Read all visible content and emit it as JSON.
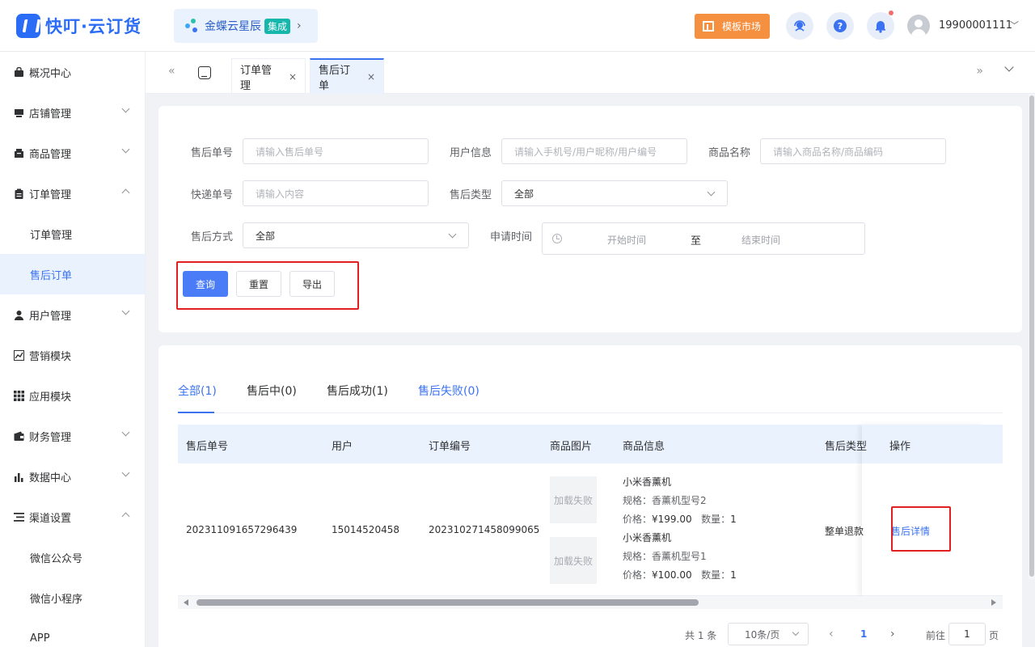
{
  "header": {
    "brand": "快叮·云订货",
    "partner": {
      "name": "金蝶云星辰",
      "badge": "集成",
      "arrow": "›"
    },
    "template_market": "模板市场",
    "username": "19900001111",
    "icons": [
      "headset-icon",
      "help-icon",
      "bell-icon"
    ],
    "colors": {
      "brand": "#2b6cf6",
      "accent": "#f59040"
    }
  },
  "sidebar": {
    "items": [
      {
        "label": "概况中心",
        "icon": "bag-icon"
      },
      {
        "label": "店铺管理",
        "icon": "shop-icon"
      },
      {
        "label": "商品管理",
        "icon": "goods-icon"
      },
      {
        "label": "订单管理",
        "icon": "clipboard-icon",
        "children": [
          "订单管理",
          "售后订单"
        ]
      },
      {
        "label": "用户管理",
        "icon": "user-icon"
      },
      {
        "label": "营销模块",
        "icon": "chart-line-icon"
      },
      {
        "label": "应用模块",
        "icon": "grid-icon"
      },
      {
        "label": "财务管理",
        "icon": "wallet-icon"
      },
      {
        "label": "数据中心",
        "icon": "bar-chart-icon"
      },
      {
        "label": "渠道设置",
        "icon": "list-icon",
        "children": [
          "微信公众号",
          "微信小程序",
          "APP"
        ]
      }
    ]
  },
  "tabs": {
    "left": "«",
    "right": "»",
    "items": [
      {
        "label": "订单管理",
        "close": "×"
      },
      {
        "label": "售后订单",
        "close": "×"
      }
    ]
  },
  "filter": {
    "after_sale_no": {
      "label": "售后单号",
      "placeholder": "请输入售后单号"
    },
    "user_info": {
      "label": "用户信息",
      "placeholder": "请输入手机号/用户昵称/用户编号"
    },
    "product_name": {
      "label": "商品名称",
      "placeholder": "请输入商品名称/商品编码"
    },
    "express_no": {
      "label": "快递单号",
      "placeholder": "请输入内容"
    },
    "after_sale_type": {
      "label": "售后类型",
      "value": "全部"
    },
    "after_sale_method": {
      "label": "售后方式",
      "value": "全部"
    },
    "apply_time": {
      "label": "申请时间",
      "start": "开始时间",
      "to": "至",
      "end": "结束时间"
    },
    "buttons": {
      "query": "查询",
      "reset": "重置",
      "export": "导出"
    }
  },
  "status_tabs": [
    "全部(1)",
    "售后中(0)",
    "售后成功(1)",
    "售后失败(0)"
  ],
  "table": {
    "columns": [
      "售后单号",
      "用户",
      "订单编号",
      "商品图片",
      "商品信息",
      "售后类型",
      "操作"
    ],
    "rows": [
      {
        "after_sale_no": "202311091657296439",
        "user": "15014520458",
        "order_no": "202310271458099065",
        "images": [
          "加载失败",
          "加载失败"
        ],
        "goods": [
          {
            "name": "小米香薰机",
            "spec": "规格：香薰机型号2",
            "price_label": "价格：",
            "price": "¥199.00",
            "qty_label": "数量：",
            "qty": "1"
          },
          {
            "name": "小米香薰机",
            "spec": "规格：香薰机型号1",
            "price_label": "价格：",
            "price": "¥100.00",
            "qty_label": "数量：",
            "qty": "1"
          }
        ],
        "type": "整单退款",
        "action": "售后详情"
      }
    ]
  },
  "pagination": {
    "total": "共 1 条",
    "page_size": "10条/页",
    "prev": "‹",
    "current": "1",
    "next": "›",
    "goto_label": "前往",
    "goto_value": "1",
    "page_suffix": "页"
  }
}
